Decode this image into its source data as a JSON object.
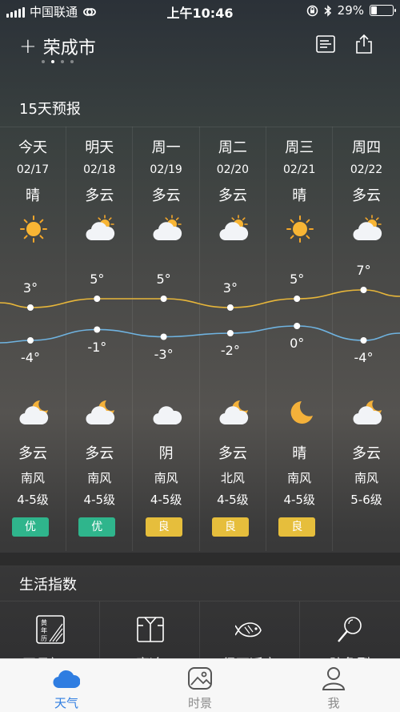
{
  "status_bar": {
    "carrier": "中国联通",
    "time": "上午10:46",
    "battery": "29%",
    "battery_level": 0.29
  },
  "header": {
    "city": "荣成市",
    "add_icon": "plus-icon",
    "list_icon": "list-icon",
    "share_icon": "share-icon",
    "page_dots": 4,
    "active_dot": 1
  },
  "forecast": {
    "title": "15天预报",
    "days": [
      {
        "day": "今天",
        "date": "02/17",
        "day_cond": "晴",
        "day_icon": "sun",
        "high": "3°",
        "low": "-4°",
        "night_icon": "moon-cloud",
        "night_cond": "多云",
        "wind": "南风",
        "level": "4-5级",
        "aqi": "优",
        "aqi_color": "#2fb58c"
      },
      {
        "day": "明天",
        "date": "02/18",
        "day_cond": "多云",
        "day_icon": "sun-cloud",
        "high": "5°",
        "low": "-1°",
        "night_icon": "moon-cloud",
        "night_cond": "多云",
        "wind": "南风",
        "level": "4-5级",
        "aqi": "优",
        "aqi_color": "#2fb58c"
      },
      {
        "day": "周一",
        "date": "02/19",
        "day_cond": "多云",
        "day_icon": "sun-cloud",
        "high": "5°",
        "low": "-3°",
        "night_icon": "cloud",
        "night_cond": "阴",
        "wind": "南风",
        "level": "4-5级",
        "aqi": "良",
        "aqi_color": "#e6be3c"
      },
      {
        "day": "周二",
        "date": "02/20",
        "day_cond": "多云",
        "day_icon": "sun-cloud",
        "high": "3°",
        "low": "-2°",
        "night_icon": "moon-cloud",
        "night_cond": "多云",
        "wind": "北风",
        "level": "4-5级",
        "aqi": "良",
        "aqi_color": "#e6be3c"
      },
      {
        "day": "周三",
        "date": "02/21",
        "day_cond": "晴",
        "day_icon": "sun",
        "high": "5°",
        "low": "0°",
        "night_icon": "moon",
        "night_cond": "晴",
        "wind": "南风",
        "level": "4-5级",
        "aqi": "良",
        "aqi_color": "#e6be3c"
      },
      {
        "day": "周四",
        "date": "02/22",
        "day_cond": "多云",
        "day_icon": "sun-cloud",
        "high": "7°",
        "low": "-4°",
        "night_icon": "moon-cloud",
        "night_cond": "多云",
        "wind": "南风",
        "level": "5-6级",
        "aqi": "",
        "aqi_color": ""
      }
    ],
    "high_values": [
      3,
      5,
      5,
      3,
      5,
      7
    ],
    "low_values": [
      -4,
      -1,
      -3,
      -2,
      0,
      -4
    ],
    "high_line_color": "#e7b63a",
    "low_line_color": "#6fb3e0"
  },
  "life_index": {
    "title": "生活指数",
    "items": [
      {
        "icon": "almanac-icon",
        "label": "正月初二",
        "icon_text": [
          "黄",
          "年",
          "历"
        ]
      },
      {
        "icon": "shirt-icon",
        "label": "寒冷"
      },
      {
        "icon": "fish-icon",
        "label": "很不适宜"
      },
      {
        "icon": "magnifier-icon",
        "label": "防龟裂"
      }
    ]
  },
  "tabbar": {
    "tabs": [
      {
        "label": "天气",
        "icon": "cloud-tab-icon",
        "active": true
      },
      {
        "label": "时景",
        "icon": "photo-tab-icon",
        "active": false
      },
      {
        "label": "我",
        "icon": "person-tab-icon",
        "active": false
      }
    ],
    "active_color": "#2f7de1"
  }
}
